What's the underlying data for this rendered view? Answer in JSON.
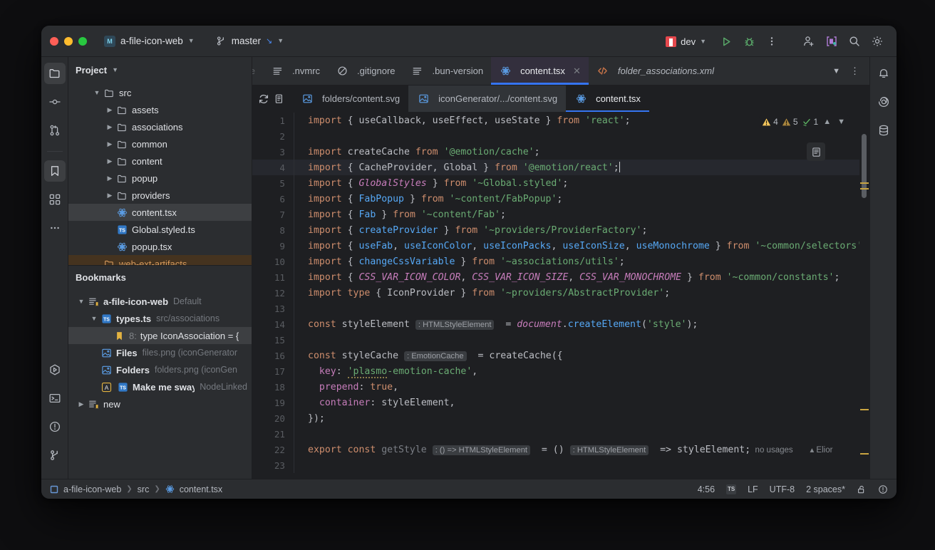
{
  "titlebar": {
    "project_badge": "M",
    "project_name": "a-file-icon-web",
    "branch_name": "master",
    "run_config": "dev",
    "icons": {
      "project_chevron": "chevron-down-icon",
      "branch": "branch-icon",
      "branch_incoming": "arrow-down-left-icon",
      "branch_chevron": "chevron-down-icon",
      "run": "run-icon",
      "debug": "debug-icon",
      "more": "more-vertical-icon",
      "add_user": "add-user-icon",
      "code_with_me": "code-with-me-icon",
      "search": "search-icon",
      "settings": "gear-icon"
    }
  },
  "left_stripe": {
    "items": [
      {
        "name": "project-icon",
        "active": true
      },
      {
        "name": "commit-icon",
        "active": false
      },
      {
        "name": "pull-requests-icon",
        "active": false
      },
      {
        "name": "bookmarks-icon",
        "active": true
      },
      {
        "name": "structure-icon",
        "active": false
      },
      {
        "name": "more-tools-icon",
        "active": false
      }
    ],
    "bottom": [
      {
        "name": "run-tool-icon"
      },
      {
        "name": "terminal-icon"
      },
      {
        "name": "problems-icon"
      },
      {
        "name": "version-control-icon"
      }
    ]
  },
  "right_stripe": {
    "items": [
      {
        "name": "notifications-bell-icon"
      },
      {
        "name": "ai-assistant-icon"
      },
      {
        "name": "database-icon"
      }
    ]
  },
  "project_panel": {
    "title": "Project",
    "tree": [
      {
        "indent": 1,
        "arrow": "down",
        "icon": "folder-icon",
        "label": "src",
        "sel": false
      },
      {
        "indent": 2,
        "arrow": "right",
        "icon": "folder-icon",
        "label": "assets",
        "sel": false
      },
      {
        "indent": 2,
        "arrow": "right",
        "icon": "folder-icon",
        "label": "associations",
        "sel": false
      },
      {
        "indent": 2,
        "arrow": "right",
        "icon": "folder-icon",
        "label": "common",
        "sel": false
      },
      {
        "indent": 2,
        "arrow": "right",
        "icon": "folder-icon",
        "label": "content",
        "sel": false
      },
      {
        "indent": 2,
        "arrow": "right",
        "icon": "folder-icon",
        "label": "popup",
        "sel": false
      },
      {
        "indent": 2,
        "arrow": "right",
        "icon": "folder-icon",
        "label": "providers",
        "sel": false
      },
      {
        "indent": 2,
        "arrow": "none",
        "icon": "react-icon",
        "label": "content.tsx",
        "sel": true
      },
      {
        "indent": 2,
        "arrow": "none",
        "icon": "typescript-icon",
        "label": "Global.styled.ts",
        "sel": false
      },
      {
        "indent": 2,
        "arrow": "none",
        "icon": "react-icon",
        "label": "popup.tsx",
        "sel": false
      },
      {
        "indent": 1,
        "arrow": "none",
        "icon": "folder-icon",
        "label": "web-ext-artifacts",
        "sel": false,
        "orange": true
      }
    ]
  },
  "bookmarks_panel": {
    "title": "Bookmarks",
    "items": [
      {
        "indent": 0,
        "arrow": "down",
        "icon": "bookmark-list-icon",
        "label": "a-file-icon-web",
        "bold": true,
        "sub": "Default",
        "sel": false
      },
      {
        "indent": 1,
        "arrow": "down",
        "icon": "typescript-icon",
        "label": "types.ts",
        "bold": true,
        "sub": "src/associations",
        "sel": false
      },
      {
        "indent": 2,
        "arrow": "none",
        "icon": "bookmark-flag-icon",
        "label": "type IconAssociation = {",
        "num": "8:",
        "bold": false,
        "sub": "",
        "sel": true
      },
      {
        "indent": 1,
        "arrow": "none",
        "icon": "image-file-icon",
        "label": "Files",
        "bold": true,
        "sub": "files.png  (iconGenerator",
        "sel": false
      },
      {
        "indent": 1,
        "arrow": "none",
        "icon": "image-file-icon",
        "label": "Folders",
        "bold": true,
        "sub": "folders.png  (iconGen",
        "sel": false
      },
      {
        "indent": 1,
        "arrow": "none",
        "icon": "mnemonic-a-icon",
        "label": "Make me sway",
        "bold": true,
        "sub": "NodeLinked",
        "sel": false,
        "extra_icon": "typescript-icon"
      },
      {
        "indent": 0,
        "arrow": "right",
        "icon": "bookmark-list-icon",
        "label": "new",
        "bold": false,
        "sub": "",
        "sel": false
      }
    ]
  },
  "editor_tabs": {
    "cut_tab": "nore",
    "tabs": [
      {
        "label": ".nvmrc",
        "icon": "text-file-icon",
        "active": false,
        "italic": false,
        "closable": false
      },
      {
        "label": ".gitignore",
        "icon": "ignore-file-icon",
        "active": false,
        "italic": false,
        "closable": false
      },
      {
        "label": ".bun-version",
        "icon": "text-file-icon",
        "active": false,
        "italic": false,
        "closable": false
      },
      {
        "label": "content.tsx",
        "icon": "react-icon",
        "active": true,
        "italic": false,
        "closable": true
      },
      {
        "label": "folder_associations.xml",
        "icon": "xml-file-icon",
        "active": false,
        "italic": true,
        "closable": false
      }
    ],
    "right_icons": [
      "chevron-down-icon",
      "more-vertical-icon"
    ]
  },
  "breadcrumbs_tabs": {
    "tools": [
      "refresh-icon",
      "copy-icon"
    ],
    "tabs": [
      {
        "label": "folders/content.svg",
        "icon": "svg-file-icon",
        "state": "normal"
      },
      {
        "label": "iconGenerator/.../content.svg",
        "icon": "svg-file-icon",
        "state": "hover"
      },
      {
        "label": "content.tsx",
        "icon": "react-icon",
        "state": "active"
      }
    ]
  },
  "inspections": {
    "warnings": "4",
    "weak_warnings": "5",
    "ok": "1",
    "up": "chevron-up-icon",
    "down": "chevron-down-icon"
  },
  "code": {
    "lines": [
      {
        "n": "1",
        "current": false,
        "tokens": [
          {
            "t": "import ",
            "c": "k"
          },
          {
            "t": "{ useCallback, useEffect, useState } ",
            "c": "id"
          },
          {
            "t": "from ",
            "c": "k"
          },
          {
            "t": "'react'",
            "c": "s"
          },
          {
            "t": ";",
            "c": "p"
          }
        ]
      },
      {
        "n": "2",
        "current": false,
        "tokens": []
      },
      {
        "n": "3",
        "current": false,
        "tokens": [
          {
            "t": "import ",
            "c": "k"
          },
          {
            "t": "createCache ",
            "c": "id"
          },
          {
            "t": "from ",
            "c": "k"
          },
          {
            "t": "'@emotion/cache'",
            "c": "s"
          },
          {
            "t": ";",
            "c": "p"
          }
        ]
      },
      {
        "n": "4",
        "current": true,
        "tokens": [
          {
            "t": "import ",
            "c": "k"
          },
          {
            "t": "{ CacheProvider, Global } ",
            "c": "id"
          },
          {
            "t": "from ",
            "c": "k"
          },
          {
            "t": "'@emotion/react'",
            "c": "s"
          },
          {
            "t": ";",
            "c": "p"
          },
          {
            "t": "|caret|",
            "c": "caret"
          }
        ]
      },
      {
        "n": "5",
        "current": false,
        "tokens": [
          {
            "t": "import ",
            "c": "k"
          },
          {
            "t": "{ ",
            "c": "id"
          },
          {
            "t": "GlobalStyles",
            "c": "ty"
          },
          {
            "t": " } ",
            "c": "id"
          },
          {
            "t": "from ",
            "c": "k"
          },
          {
            "t": "'~Global.styled'",
            "c": "s"
          },
          {
            "t": ";",
            "c": "p"
          }
        ]
      },
      {
        "n": "6",
        "current": false,
        "tokens": [
          {
            "t": "import ",
            "c": "k"
          },
          {
            "t": "{ ",
            "c": "id"
          },
          {
            "t": "FabPopup",
            "c": "fn"
          },
          {
            "t": " } ",
            "c": "id"
          },
          {
            "t": "from ",
            "c": "k"
          },
          {
            "t": "'~content/FabPopup'",
            "c": "s"
          },
          {
            "t": ";",
            "c": "p"
          }
        ]
      },
      {
        "n": "7",
        "current": false,
        "tokens": [
          {
            "t": "import ",
            "c": "k"
          },
          {
            "t": "{ ",
            "c": "id"
          },
          {
            "t": "Fab",
            "c": "fn"
          },
          {
            "t": " } ",
            "c": "id"
          },
          {
            "t": "from ",
            "c": "k"
          },
          {
            "t": "'~content/Fab'",
            "c": "s"
          },
          {
            "t": ";",
            "c": "p"
          }
        ]
      },
      {
        "n": "8",
        "current": false,
        "tokens": [
          {
            "t": "import ",
            "c": "k"
          },
          {
            "t": "{ ",
            "c": "id"
          },
          {
            "t": "createProvider",
            "c": "fn"
          },
          {
            "t": " } ",
            "c": "id"
          },
          {
            "t": "from ",
            "c": "k"
          },
          {
            "t": "'~providers/ProviderFactory'",
            "c": "s"
          },
          {
            "t": ";",
            "c": "p"
          }
        ]
      },
      {
        "n": "9",
        "current": false,
        "tokens": [
          {
            "t": "import ",
            "c": "k"
          },
          {
            "t": "{ ",
            "c": "id"
          },
          {
            "t": "useFab",
            "c": "fn"
          },
          {
            "t": ", ",
            "c": "id"
          },
          {
            "t": "useIconColor",
            "c": "fn"
          },
          {
            "t": ", ",
            "c": "id"
          },
          {
            "t": "useIconPacks",
            "c": "fn"
          },
          {
            "t": ", ",
            "c": "id"
          },
          {
            "t": "useIconSize",
            "c": "fn"
          },
          {
            "t": ", ",
            "c": "id"
          },
          {
            "t": "useMonochrome",
            "c": "fn"
          },
          {
            "t": " } ",
            "c": "id"
          },
          {
            "t": "from ",
            "c": "k"
          },
          {
            "t": "'~common/selectors'",
            "c": "s"
          },
          {
            "t": ";",
            "c": "p"
          }
        ]
      },
      {
        "n": "10",
        "current": false,
        "tokens": [
          {
            "t": "import ",
            "c": "k"
          },
          {
            "t": "{ ",
            "c": "id"
          },
          {
            "t": "changeCssVariable",
            "c": "fn"
          },
          {
            "t": " } ",
            "c": "id"
          },
          {
            "t": "from ",
            "c": "k"
          },
          {
            "t": "'~associations/utils'",
            "c": "s"
          },
          {
            "t": ";",
            "c": "p"
          }
        ]
      },
      {
        "n": "11",
        "current": false,
        "tokens": [
          {
            "t": "import ",
            "c": "k"
          },
          {
            "t": "{ ",
            "c": "id"
          },
          {
            "t": "CSS_VAR_ICON_COLOR",
            "c": "ty"
          },
          {
            "t": ", ",
            "c": "id"
          },
          {
            "t": "CSS_VAR_ICON_SIZE",
            "c": "ty"
          },
          {
            "t": ", ",
            "c": "id"
          },
          {
            "t": "CSS_VAR_MONOCHROME",
            "c": "ty"
          },
          {
            "t": " } ",
            "c": "id"
          },
          {
            "t": "from ",
            "c": "k"
          },
          {
            "t": "'~common/constants'",
            "c": "s"
          },
          {
            "t": ";",
            "c": "p"
          }
        ]
      },
      {
        "n": "12",
        "current": false,
        "tokens": [
          {
            "t": "import type ",
            "c": "k"
          },
          {
            "t": "{ IconProvider } ",
            "c": "id"
          },
          {
            "t": "from ",
            "c": "k"
          },
          {
            "t": "'~providers/AbstractProvider'",
            "c": "s"
          },
          {
            "t": ";",
            "c": "p"
          }
        ]
      },
      {
        "n": "13",
        "current": false,
        "tokens": []
      },
      {
        "n": "14",
        "current": false,
        "tokens": [
          {
            "t": "const ",
            "c": "k"
          },
          {
            "t": "styleElement",
            "c": "id"
          },
          {
            "t": " ",
            "c": "p"
          },
          {
            "t": ": HTMLStyleElement",
            "c": "hint"
          },
          {
            "t": "  = ",
            "c": "p"
          },
          {
            "t": "document",
            "c": "doc"
          },
          {
            "t": ".",
            "c": "p"
          },
          {
            "t": "createElement",
            "c": "fn"
          },
          {
            "t": "(",
            "c": "p"
          },
          {
            "t": "'style'",
            "c": "s"
          },
          {
            "t": ");",
            "c": "p"
          }
        ]
      },
      {
        "n": "15",
        "current": false,
        "tokens": []
      },
      {
        "n": "16",
        "current": false,
        "tokens": [
          {
            "t": "const ",
            "c": "k"
          },
          {
            "t": "styleCache",
            "c": "id"
          },
          {
            "t": " ",
            "c": "p"
          },
          {
            "t": ": EmotionCache",
            "c": "hint"
          },
          {
            "t": "  = ",
            "c": "p"
          },
          {
            "t": "createCache",
            "c": "id"
          },
          {
            "t": "({",
            "c": "p"
          }
        ]
      },
      {
        "n": "17",
        "current": false,
        "tokens": [
          {
            "t": "  ",
            "c": "p"
          },
          {
            "t": "key",
            "c": "pr"
          },
          {
            "t": ": ",
            "c": "p"
          },
          {
            "t": "'plasmo",
            "c": "s-squig"
          },
          {
            "t": "-emotion-cache'",
            "c": "s"
          },
          {
            "t": ",",
            "c": "p"
          }
        ]
      },
      {
        "n": "18",
        "current": false,
        "tokens": [
          {
            "t": "  ",
            "c": "p"
          },
          {
            "t": "prepend",
            "c": "pr"
          },
          {
            "t": ": ",
            "c": "p"
          },
          {
            "t": "true",
            "c": "k"
          },
          {
            "t": ",",
            "c": "p"
          }
        ]
      },
      {
        "n": "19",
        "current": false,
        "tokens": [
          {
            "t": "  ",
            "c": "p"
          },
          {
            "t": "container",
            "c": "pr"
          },
          {
            "t": ": ",
            "c": "p"
          },
          {
            "t": "styleElement",
            "c": "id"
          },
          {
            "t": ",",
            "c": "p"
          }
        ]
      },
      {
        "n": "20",
        "current": false,
        "tokens": [
          {
            "t": "});",
            "c": "p"
          }
        ]
      },
      {
        "n": "21",
        "current": false,
        "tokens": []
      },
      {
        "n": "22",
        "current": false,
        "tokens": [
          {
            "t": "export const ",
            "c": "k"
          },
          {
            "t": "getStyle",
            "c": "dim"
          },
          {
            "t": " ",
            "c": "p"
          },
          {
            "t": ": () => HTMLStyleElement",
            "c": "hint"
          },
          {
            "t": "  = ",
            "c": "p"
          },
          {
            "t": "()",
            "c": "p"
          },
          {
            "t": " ",
            "c": "p"
          },
          {
            "t": ": HTMLStyleElement",
            "c": "hint"
          },
          {
            "t": "  => ",
            "c": "p"
          },
          {
            "t": "styleElement",
            "c": "id"
          },
          {
            "t": ";",
            "c": "p"
          },
          {
            "t": "  no usages",
            "c": "hint-plain"
          },
          {
            "t": "   ",
            "c": "p"
          },
          {
            "t": "▴ Elior",
            "c": "hint-plain"
          }
        ]
      },
      {
        "n": "23",
        "current": false,
        "tokens": []
      }
    ]
  },
  "statusbar": {
    "breadcrumbs": [
      "a-file-icon-web",
      "src",
      "content.tsx"
    ],
    "position": "4:56",
    "file_type_badge": "TS",
    "line_separator": "LF",
    "encoding": "UTF-8",
    "indent": "2 spaces*",
    "icons": [
      "unlock-icon",
      "inspections-widget-icon"
    ]
  },
  "colors": {
    "accent_blue": "#3574f0",
    "window_chrome": "#2b2d30",
    "editor_bg": "#1e1f22",
    "active_tab_bg": "#332f3d",
    "warning": "#c9a441",
    "string_green": "#6aab73",
    "keyword_orange": "#cf8e6d",
    "type_purple": "#c77dbb",
    "fn_blue": "#56a8f5",
    "orange_row": "#45331f"
  }
}
